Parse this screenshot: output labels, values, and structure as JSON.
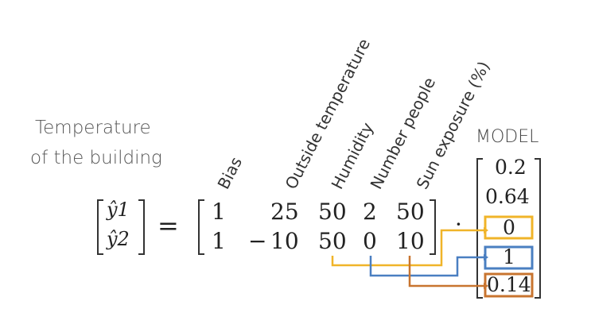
{
  "title": {
    "line1": "Temperature",
    "line2": "of the building"
  },
  "features": [
    "Bias",
    "Outside temperature",
    "Humidity",
    "Number people",
    "Sun exposure (%)"
  ],
  "model_label": "MODEL",
  "outputs": [
    "ŷ1",
    "ŷ2"
  ],
  "equals": "=",
  "dot": "·",
  "minus": "−",
  "matrix": {
    "row1": [
      "1",
      "25",
      "50",
      "2",
      "50"
    ],
    "row2": [
      "1",
      "10",
      "50",
      "0",
      "10"
    ]
  },
  "weights": [
    "0.2",
    "0.64",
    "0",
    "1",
    "0.14"
  ],
  "colors": {
    "humidity": "#F0B429",
    "number_people": "#4A7FC1",
    "sun_exposure": "#C8742F"
  }
}
